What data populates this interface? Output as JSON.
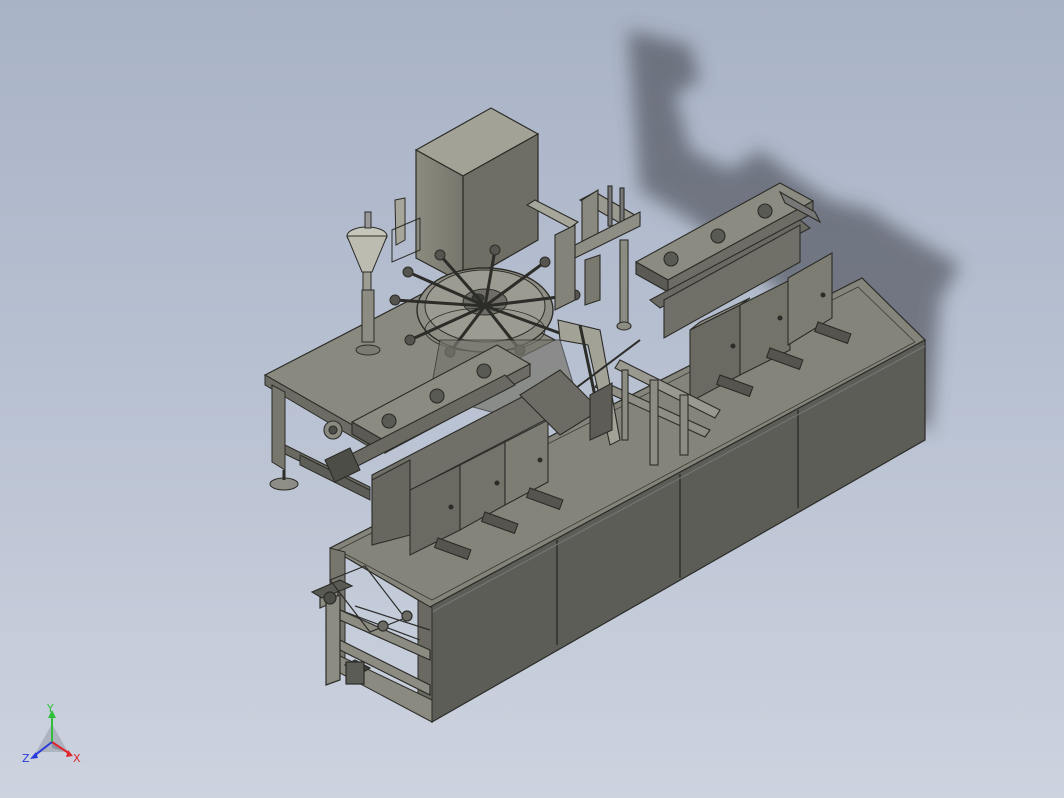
{
  "viewport": {
    "type": "cad-3d-viewport",
    "background_colors": [
      "#a9b3c6",
      "#cdd3df"
    ],
    "model_color": "#8a8a82",
    "edge_color": "#2f2f2b",
    "display_mode": "shaded-with-edges"
  },
  "triad": {
    "x_label": "X",
    "y_label": "Y",
    "z_label": "Z",
    "x_color": "#e0262c",
    "y_color": "#2fbf3a",
    "z_color": "#2a3ad8"
  }
}
